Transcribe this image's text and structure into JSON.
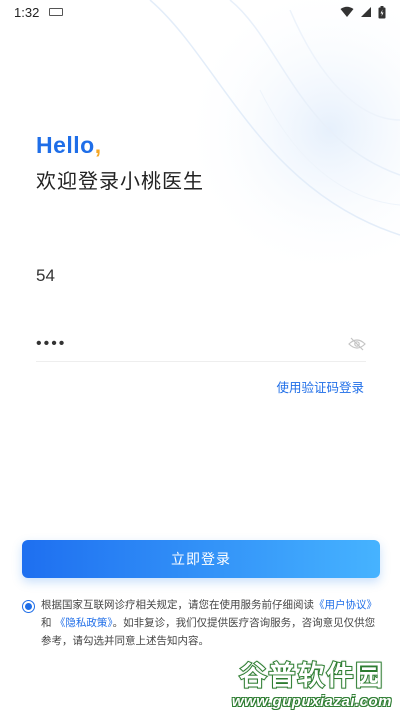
{
  "status_bar": {
    "time": "1:32"
  },
  "header": {
    "hello": "Hello",
    "hello_comma": ",",
    "welcome": "欢迎登录小桃医生"
  },
  "form": {
    "phone_value": "54",
    "password_value": "••••",
    "sms_login_link": "使用验证码登录"
  },
  "login_button": "立即登录",
  "agreement": {
    "text_1": "根据国家互联网诊疗相关规定，请您在使用服务前仔细阅读",
    "user_agreement": "《用户协议》",
    "and": "和",
    "privacy_policy": "《隐私政策》",
    "text_2": "。如非复诊，我们仅提供医疗咨询服务，咨询意见仅供您参考，请勾选并同意上述告知内容。",
    "checked": true
  },
  "watermark": {
    "title": "谷普软件园",
    "url": "www.gupuxiazai.com"
  },
  "colors": {
    "accent": "#1f6ee8",
    "button_gradient_start": "#1e6ff0",
    "button_gradient_end": "#46b3ff",
    "comma": "#f5a623",
    "watermark_green": "#2e7d32"
  },
  "icons": [
    "keyboard-icon",
    "wifi-icon",
    "cellular-signal-icon",
    "battery-icon",
    "eye-closed-icon"
  ]
}
